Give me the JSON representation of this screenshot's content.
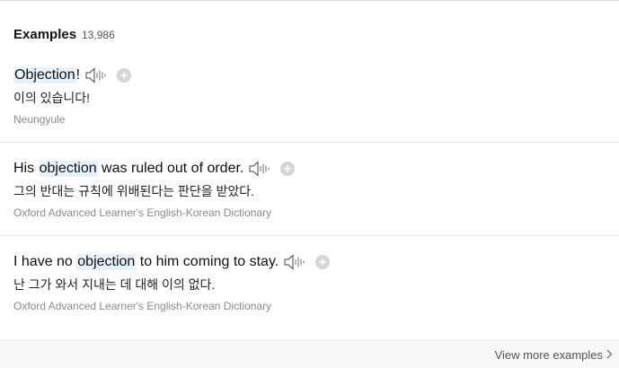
{
  "examples": {
    "title": "Examples",
    "count": "13,986",
    "items": [
      {
        "before": "",
        "highlight": "Objection",
        "after": "!",
        "translation": "이의 있습니다!",
        "source": "Neungyule"
      },
      {
        "before": "His ",
        "highlight": "objection",
        "after": " was ruled out of order.",
        "translation": "그의 반대는 규칙에 위배된다는 판단을 받았다.",
        "source": "Oxford Advanced Learner's English-Korean Dictionary"
      },
      {
        "before": "I have no ",
        "highlight": "objection",
        "after": " to him coming to stay.",
        "translation": "난 그가 와서 지내는 데 대해 이의 없다.",
        "source": "Oxford Advanced Learner's English-Korean Dictionary"
      }
    ]
  },
  "footer": {
    "view_more_label": "View more examples"
  },
  "icons": {
    "speaker": "speaker-icon",
    "add": "plus-circle-icon",
    "chevron": "chevron-right-icon"
  },
  "colors": {
    "highlight": "#e5f1fc",
    "plus_circle": "#d6d6d6",
    "source_text": "#8a8a8a"
  }
}
